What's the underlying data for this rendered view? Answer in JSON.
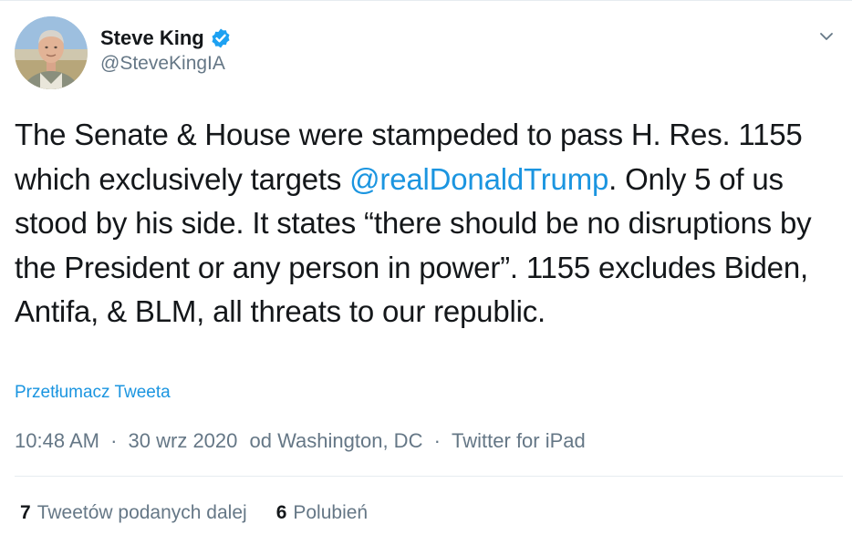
{
  "author": {
    "display_name": "Steve King",
    "handle": "@SteveKingIA",
    "verified": true
  },
  "tweet": {
    "text_before_mention": "The Senate & House were stampeded to pass H. Res. 1155 which exclusively targets ",
    "mention": "@realDonaldTrump",
    "text_after_mention": ". Only 5 of us stood by his side. It states “there should be no disruptions by the President or any person in power”. 1155 excludes Biden, Antifa, & BLM, all threats to our republic.",
    "translate_label": "Przetłumacz Tweeta"
  },
  "meta": {
    "time": "10:48 AM",
    "separator": "·",
    "date": "30 wrz 2020",
    "location": "od Washington, DC",
    "source": "Twitter for iPad"
  },
  "stats": {
    "retweets_count": "7",
    "retweets_label": "Tweetów podanych dalej",
    "likes_count": "6",
    "likes_label": "Polubień"
  },
  "colors": {
    "link": "#1b95e0",
    "secondary_text": "#657786",
    "primary_text": "#14171a",
    "verified_badge": "#1da1f2",
    "divider": "#e6ecf0"
  },
  "icons": {
    "verified": "verified-badge-icon",
    "caret": "chevron-down-icon",
    "avatar": "profile-photo"
  }
}
